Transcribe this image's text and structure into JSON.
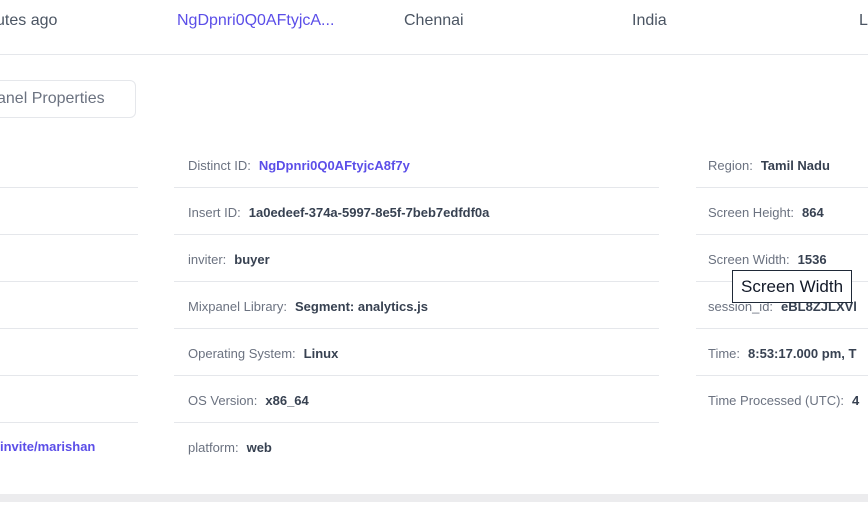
{
  "event_row": {
    "time": "utes ago",
    "distinct_id": "NgDpnri0Q0AFtyjcA...",
    "city": "Chennai",
    "country": "India",
    "extra": "L"
  },
  "panel_button": {
    "label": "anel Properties"
  },
  "left_column": {
    "last_value": "invite/marishan"
  },
  "middle_column": [
    {
      "label": "Distinct ID:",
      "value": "NgDpnri0Q0AFtyjcA8f7y",
      "link": true
    },
    {
      "label": "Insert ID:",
      "value": "1a0edeef-374a-5997-8e5f-7beb7edfdf0a",
      "link": false
    },
    {
      "label": "inviter:",
      "value": "buyer",
      "link": false
    },
    {
      "label": "Mixpanel Library:",
      "value": "Segment: analytics.js",
      "link": false
    },
    {
      "label": "Operating System:",
      "value": "Linux",
      "link": false
    },
    {
      "label": "OS Version:",
      "value": "x86_64",
      "link": false
    },
    {
      "label": "platform:",
      "value": "web",
      "link": false
    }
  ],
  "right_column": [
    {
      "label": "Region:",
      "value": "Tamil Nadu"
    },
    {
      "label": "Screen Height:",
      "value": "864"
    },
    {
      "label": "Screen Width:",
      "value": "1536"
    },
    {
      "label": "session_id:",
      "value": "eBL8ZJLXVl"
    },
    {
      "label": "Time:",
      "value": "8:53:17.000 pm, T"
    },
    {
      "label": "Time Processed (UTC):",
      "value": "4"
    }
  ],
  "tooltip": {
    "text": "Screen Width"
  }
}
